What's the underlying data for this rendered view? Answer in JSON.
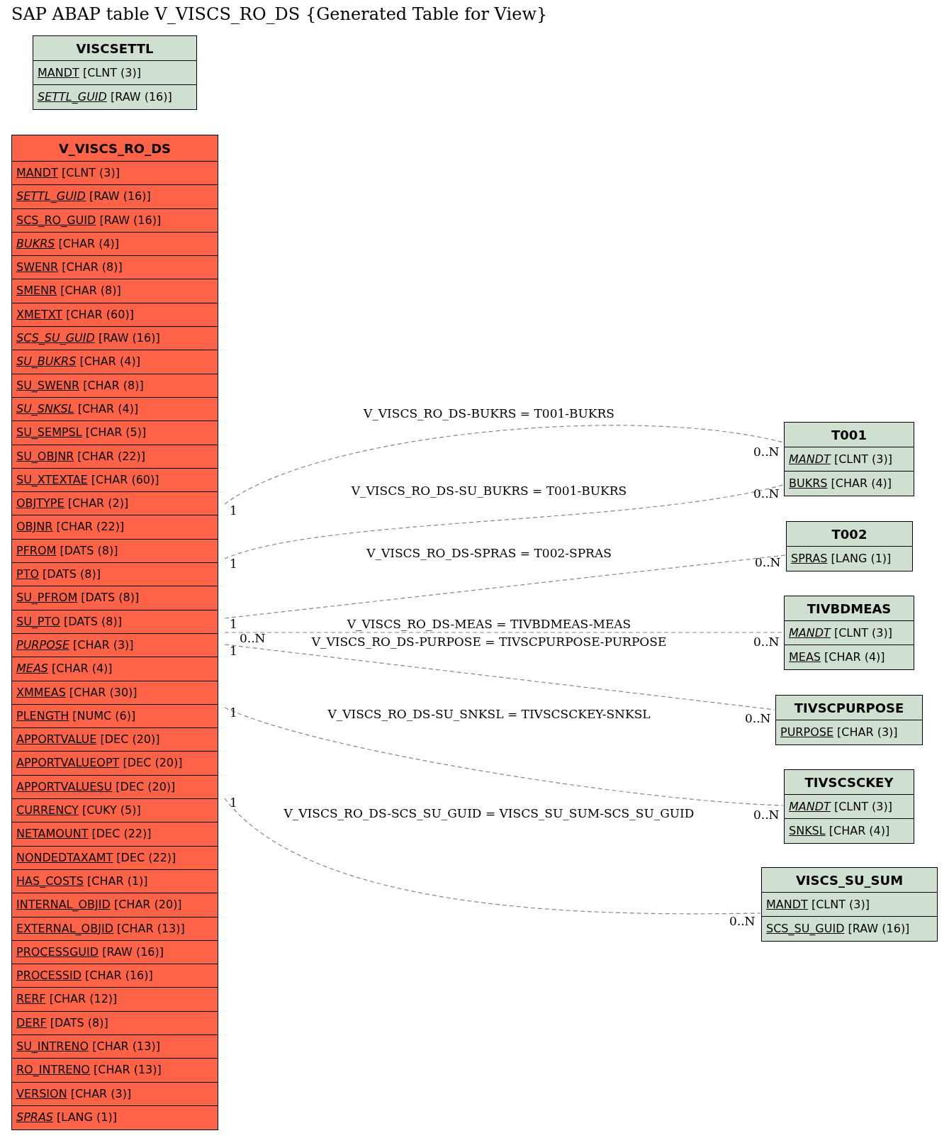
{
  "title": "SAP ABAP table V_VISCS_RO_DS {Generated Table for View}",
  "tables": [
    {
      "name": "VISCSETTL",
      "color": "#d0e0d0",
      "fields": [
        {
          "name": "MANDT",
          "type": "[CLNT (3)]",
          "foreign_key": false
        },
        {
          "name": "SETTL_GUID",
          "type": "[RAW (16)]",
          "foreign_key": true
        }
      ]
    },
    {
      "name": "V_VISCS_RO_DS",
      "color": "#ff6347",
      "fields": [
        {
          "name": "MANDT",
          "type": "[CLNT (3)]",
          "foreign_key": false
        },
        {
          "name": "SETTL_GUID",
          "type": "[RAW (16)]",
          "foreign_key": true
        },
        {
          "name": "SCS_RO_GUID",
          "type": "[RAW (16)]",
          "foreign_key": false
        },
        {
          "name": "BUKRS",
          "type": "[CHAR (4)]",
          "foreign_key": true
        },
        {
          "name": "SWENR",
          "type": "[CHAR (8)]",
          "foreign_key": false
        },
        {
          "name": "SMENR",
          "type": "[CHAR (8)]",
          "foreign_key": false
        },
        {
          "name": "XMETXT",
          "type": "[CHAR (60)]",
          "foreign_key": false
        },
        {
          "name": "SCS_SU_GUID",
          "type": "[RAW (16)]",
          "foreign_key": true
        },
        {
          "name": "SU_BUKRS",
          "type": "[CHAR (4)]",
          "foreign_key": true
        },
        {
          "name": "SU_SWENR",
          "type": "[CHAR (8)]",
          "foreign_key": false
        },
        {
          "name": "SU_SNKSL",
          "type": "[CHAR (4)]",
          "foreign_key": true
        },
        {
          "name": "SU_SEMPSL",
          "type": "[CHAR (5)]",
          "foreign_key": false
        },
        {
          "name": "SU_OBJNR",
          "type": "[CHAR (22)]",
          "foreign_key": false
        },
        {
          "name": "SU_XTEXTAE",
          "type": "[CHAR (60)]",
          "foreign_key": false
        },
        {
          "name": "OBJTYPE",
          "type": "[CHAR (2)]",
          "foreign_key": false
        },
        {
          "name": "OBJNR",
          "type": "[CHAR (22)]",
          "foreign_key": false
        },
        {
          "name": "PFROM",
          "type": "[DATS (8)]",
          "foreign_key": false
        },
        {
          "name": "PTO",
          "type": "[DATS (8)]",
          "foreign_key": false
        },
        {
          "name": "SU_PFROM",
          "type": "[DATS (8)]",
          "foreign_key": false
        },
        {
          "name": "SU_PTO",
          "type": "[DATS (8)]",
          "foreign_key": false
        },
        {
          "name": "PURPOSE",
          "type": "[CHAR (3)]",
          "foreign_key": true
        },
        {
          "name": "MEAS",
          "type": "[CHAR (4)]",
          "foreign_key": true
        },
        {
          "name": "XMMEAS",
          "type": "[CHAR (30)]",
          "foreign_key": false
        },
        {
          "name": "PLENGTH",
          "type": "[NUMC (6)]",
          "foreign_key": false
        },
        {
          "name": "APPORTVALUE",
          "type": "[DEC (20)]",
          "foreign_key": false
        },
        {
          "name": "APPORTVALUEOPT",
          "type": "[DEC (20)]",
          "foreign_key": false
        },
        {
          "name": "APPORTVALUESU",
          "type": "[DEC (20)]",
          "foreign_key": false
        },
        {
          "name": "CURRENCY",
          "type": "[CUKY (5)]",
          "foreign_key": false
        },
        {
          "name": "NETAMOUNT",
          "type": "[DEC (22)]",
          "foreign_key": false
        },
        {
          "name": "NONDEDTAXAMT",
          "type": "[DEC (22)]",
          "foreign_key": false
        },
        {
          "name": "HAS_COSTS",
          "type": "[CHAR (1)]",
          "foreign_key": false
        },
        {
          "name": "INTERNAL_OBJID",
          "type": "[CHAR (20)]",
          "foreign_key": false
        },
        {
          "name": "EXTERNAL_OBJID",
          "type": "[CHAR (13)]",
          "foreign_key": false
        },
        {
          "name": "PROCESSGUID",
          "type": "[RAW (16)]",
          "foreign_key": false
        },
        {
          "name": "PROCESSID",
          "type": "[CHAR (16)]",
          "foreign_key": false
        },
        {
          "name": "RERF",
          "type": "[CHAR (12)]",
          "foreign_key": false
        },
        {
          "name": "DERF",
          "type": "[DATS (8)]",
          "foreign_key": false
        },
        {
          "name": "SU_INTRENO",
          "type": "[CHAR (13)]",
          "foreign_key": false
        },
        {
          "name": "RO_INTRENO",
          "type": "[CHAR (13)]",
          "foreign_key": false
        },
        {
          "name": "VERSION",
          "type": "[CHAR (3)]",
          "foreign_key": false
        },
        {
          "name": "SPRAS",
          "type": "[LANG (1)]",
          "foreign_key": true
        }
      ]
    },
    {
      "name": "T001",
      "color": "#d0e0d0",
      "fields": [
        {
          "name": "MANDT",
          "type": "[CLNT (3)]",
          "foreign_key": true
        },
        {
          "name": "BUKRS",
          "type": "[CHAR (4)]",
          "foreign_key": false
        }
      ]
    },
    {
      "name": "T002",
      "color": "#d0e0d0",
      "fields": [
        {
          "name": "SPRAS",
          "type": "[LANG (1)]",
          "foreign_key": false
        }
      ]
    },
    {
      "name": "TIVBDMEAS",
      "color": "#d0e0d0",
      "fields": [
        {
          "name": "MANDT",
          "type": "[CLNT (3)]",
          "foreign_key": true
        },
        {
          "name": "MEAS",
          "type": "[CHAR (4)]",
          "foreign_key": false
        }
      ]
    },
    {
      "name": "TIVSCPURPOSE",
      "color": "#d0e0d0",
      "fields": [
        {
          "name": "PURPOSE",
          "type": "[CHAR (3)]",
          "foreign_key": false
        }
      ]
    },
    {
      "name": "TIVSCSCKEY",
      "color": "#d0e0d0",
      "fields": [
        {
          "name": "MANDT",
          "type": "[CLNT (3)]",
          "foreign_key": true
        },
        {
          "name": "SNKSL",
          "type": "[CHAR (4)]",
          "foreign_key": false
        }
      ]
    },
    {
      "name": "VISCS_SU_SUM",
      "color": "#d0e0d0",
      "fields": [
        {
          "name": "MANDT",
          "type": "[CLNT (3)]",
          "foreign_key": false
        },
        {
          "name": "SCS_SU_GUID",
          "type": "[RAW (16)]",
          "foreign_key": false
        }
      ]
    }
  ],
  "relations": [
    {
      "label": "V_VISCS_RO_DS-BUKRS = T001-BUKRS",
      "from_card": "1",
      "to_card": "0..N"
    },
    {
      "label": "V_VISCS_RO_DS-SU_BUKRS = T001-BUKRS",
      "from_card": "1",
      "to_card": "0..N"
    },
    {
      "label": "V_VISCS_RO_DS-SPRAS = T002-SPRAS",
      "from_card": "1",
      "to_card": "0..N"
    },
    {
      "label": "V_VISCS_RO_DS-MEAS = TIVBDMEAS-MEAS",
      "from_card": "0..N",
      "to_card": "0..N"
    },
    {
      "label": "V_VISCS_RO_DS-PURPOSE = TIVSCPURPOSE-PURPOSE",
      "from_card": "1",
      "to_card": "0..N"
    },
    {
      "label": "V_VISCS_RO_DS-SU_SNKSL = TIVSCSCKEY-SNKSL",
      "from_card": "1",
      "to_card": "0..N"
    },
    {
      "label": "V_VISCS_RO_DS-SCS_SU_GUID = VISCS_SU_SUM-SCS_SU_GUID",
      "from_card": "1",
      "to_card": "0..N"
    }
  ]
}
